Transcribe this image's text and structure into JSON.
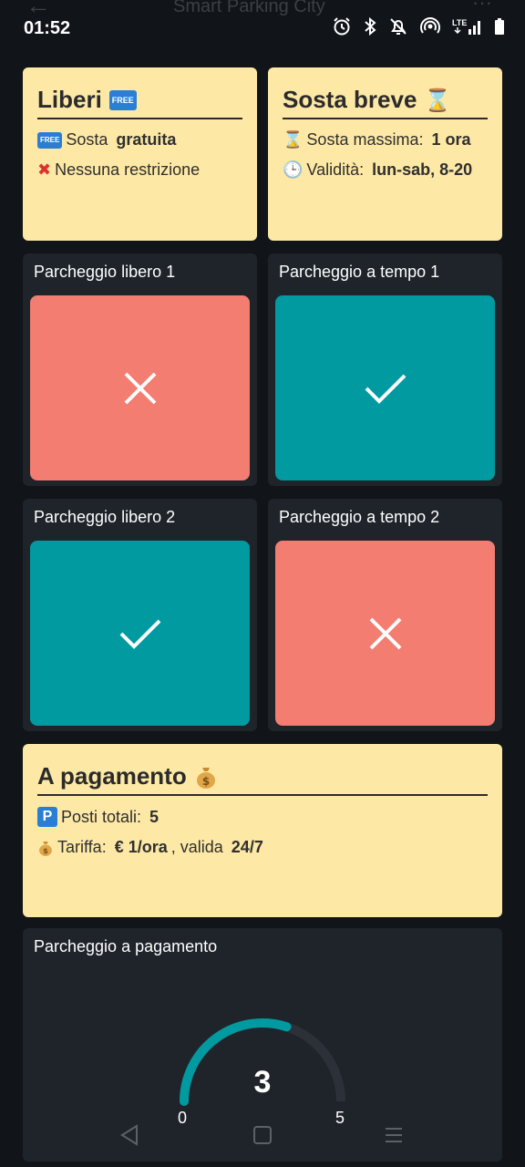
{
  "status_bar": {
    "ghost_title": "Smart Parking City",
    "time": "01:52",
    "network": "LTE"
  },
  "cards": {
    "liberi": {
      "title": "Liberi",
      "badge": "FREE",
      "line1_prefix": "Sosta ",
      "line1_bold": "gratuita",
      "line2": "Nessuna restrizione"
    },
    "sosta_breve": {
      "title": "Sosta breve",
      "line1_prefix": "Sosta massima: ",
      "line1_bold": "1 ora",
      "line2_prefix": "Validità: ",
      "line2_bold": "lun-sab, 8-20"
    },
    "a_pagamento": {
      "title": "A pagamento",
      "line1_prefix": "Posti totali: ",
      "line1_bold": "5",
      "line2_prefix": "Tariffa: ",
      "line2_bold1": "€ 1/ora",
      "line2_mid": ", valida ",
      "line2_bold2": "24/7"
    }
  },
  "spots": [
    {
      "label": "Parcheggio libero 1",
      "status": "occupied"
    },
    {
      "label": "Parcheggio a tempo 1",
      "status": "free"
    },
    {
      "label": "Parcheggio libero 2",
      "status": "free"
    },
    {
      "label": "Parcheggio a tempo 2",
      "status": "occupied"
    }
  ],
  "gauge": {
    "label": "Parcheggio a pagamento",
    "value": 3,
    "min": 0,
    "max": 5,
    "value_text": "3",
    "min_text": "0",
    "max_text": "5"
  },
  "colors": {
    "occupied": "#f27d70",
    "free": "#019aa0",
    "card_bg": "#fde9a5",
    "tile_bg": "#1f242a",
    "gauge_fill": "#019aa0",
    "gauge_track": "#2c3139"
  },
  "icons": {
    "occupied": "x-icon",
    "free": "check-icon",
    "sosta_breve_title": "hourglass-icon",
    "sosta_breve_line1": "hourglass-icon",
    "sosta_breve_line2": "clock-icon",
    "liberi_line2": "cross-mark-icon",
    "pagamento_title": "money-bag-icon",
    "pagamento_line1": "parking-icon",
    "pagamento_line2": "money-bag-icon"
  }
}
